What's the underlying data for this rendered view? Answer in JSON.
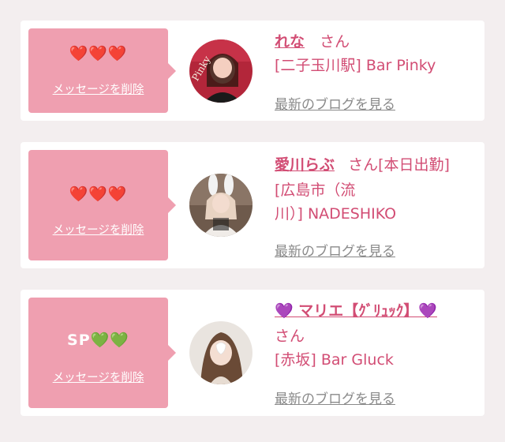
{
  "cards": [
    {
      "badge": "❤️❤️❤️",
      "delete_label": "メッセージを削除",
      "name": "れな",
      "san": "さん",
      "shop": "[二子玉川駅] Bar Pinky",
      "blog": "最新のブログを見る"
    },
    {
      "badge": "❤️❤️❤️",
      "delete_label": "メッセージを削除",
      "name": "愛川らぶ",
      "san": "さん[本日出勤]",
      "shop_line1": "[広島市（流",
      "shop_line2": "川）] NADESHIKO",
      "blog": "最新のブログを見る"
    },
    {
      "badge": "SP💚💚",
      "delete_label": "メッセージを削除",
      "name": "💜 マリエ【ｸﾞﾘｭｯｸ】💜",
      "san": "さん",
      "shop": "[赤坂] Bar Gluck",
      "blog": "最新のブログを見る"
    }
  ],
  "colors": {
    "background": "#f3eeef",
    "card": "#ffffff",
    "badge": "#ef9fb0",
    "name": "#d24d74",
    "blog_link": "#8a8a8a"
  }
}
